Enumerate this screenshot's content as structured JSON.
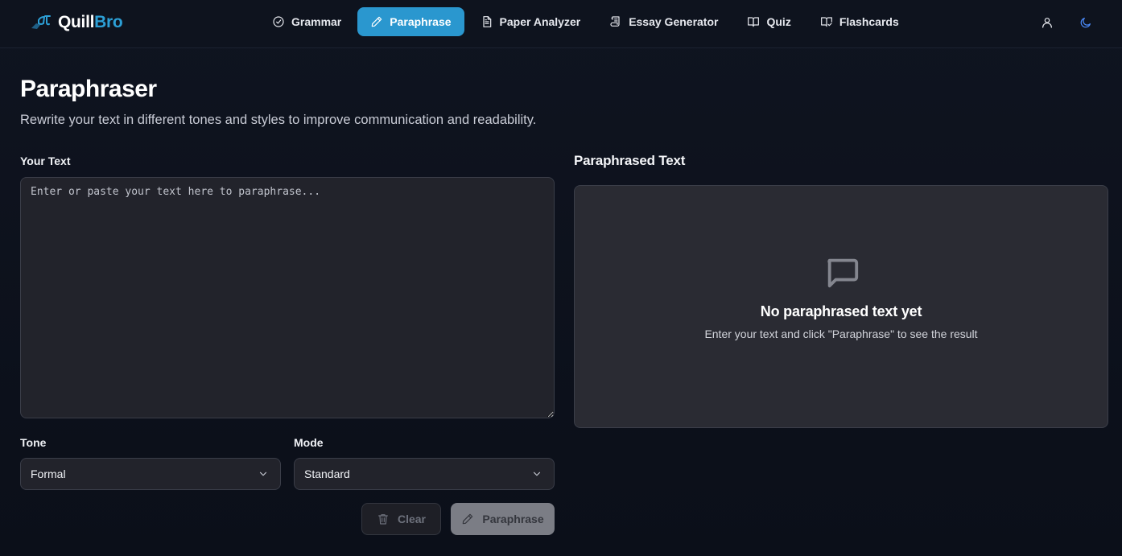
{
  "brand": {
    "name_part1": "Quill",
    "name_part2": "Bro",
    "primary_color": "#2c9fd6"
  },
  "nav": {
    "items": [
      {
        "label": "Grammar",
        "icon": "check-circle-icon",
        "active": false
      },
      {
        "label": "Paraphrase",
        "icon": "pencil-icon",
        "active": true
      },
      {
        "label": "Paper Analyzer",
        "icon": "document-icon",
        "active": false
      },
      {
        "label": "Essay Generator",
        "icon": "scroll-icon",
        "active": false
      },
      {
        "label": "Quiz",
        "icon": "book-open-icon",
        "active": false
      },
      {
        "label": "Flashcards",
        "icon": "book-check-icon",
        "active": false
      }
    ],
    "right_icons": [
      "user-icon",
      "moon-icon"
    ]
  },
  "page": {
    "title": "Paraphraser",
    "subtitle": "Rewrite your text in different tones and styles to improve communication and readability."
  },
  "input": {
    "label": "Your Text",
    "placeholder": "Enter or paste your text here to paraphrase...",
    "value": ""
  },
  "options": {
    "tone_label": "Tone",
    "tone_value": "Formal",
    "mode_label": "Mode",
    "mode_value": "Standard"
  },
  "actions": {
    "clear_label": "Clear",
    "paraphrase_label": "Paraphrase"
  },
  "result": {
    "title": "Paraphrased Text",
    "empty_title": "No paraphrased text yet",
    "empty_description": "Enter your text and click \"Paraphrase\" to see the result",
    "empty_icon": "message-square-icon"
  },
  "colors": {
    "background": "#0d111b",
    "active_tab": "#2a97cf",
    "panel": "#2a2b33",
    "input": "#22232b"
  }
}
